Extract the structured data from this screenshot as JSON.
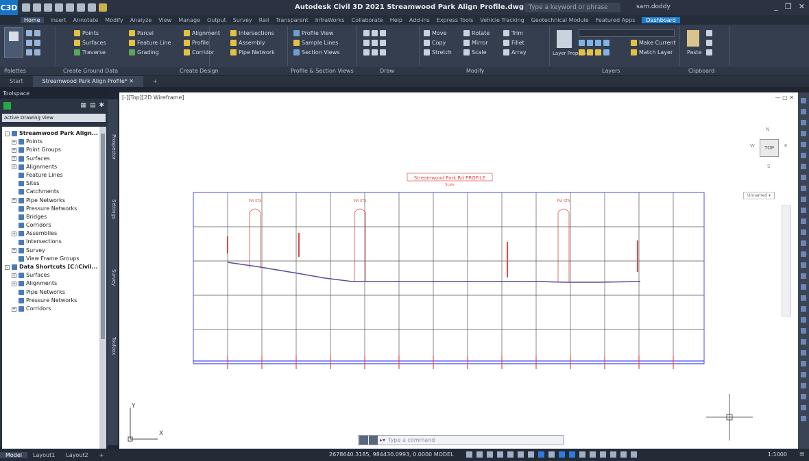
{
  "window": {
    "title": "Autodesk Civil 3D 2021   Streamwood Park Align Profile.dwg",
    "search_placeholder": "Type a keyword or phrase",
    "user": "sam.doddy",
    "min": "_",
    "restore": "❐",
    "close": "✕"
  },
  "ribbon_tabs": [
    "Home",
    "Insert",
    "Annotate",
    "Modify",
    "Analyze",
    "View",
    "Manage",
    "Output",
    "Survey",
    "Rail",
    "Transparent",
    "InfraWorks",
    "Collaborate",
    "Help",
    "Add-ins",
    "Express Tools",
    "Vehicle Tracking",
    "Geotechnical Module",
    "Featured Apps",
    "Dashboard"
  ],
  "ribbon": {
    "palettes_label": "Toolspace",
    "panels": {
      "palettes": "Palettes",
      "create_ground": "Create Ground Data",
      "create_design": "Create Design",
      "profile_section": "Profile & Section Views",
      "draw": "Draw",
      "modify": "Modify",
      "layers": "Layers",
      "clipboard": "Clipboard"
    },
    "create_ground_items": [
      "Points",
      "Surfaces",
      "Traverse"
    ],
    "create_ground_items2": [
      "Parcel",
      "Feature Line",
      "Grading"
    ],
    "create_design_items": [
      "Alignment",
      "Profile",
      "Corridor"
    ],
    "create_design_items2": [
      "Intersections",
      "Assembly",
      "Pipe Network"
    ],
    "profile_items": [
      "Profile View",
      "Sample Lines",
      "Section Views"
    ],
    "modify_items": [
      "Move",
      "Copy",
      "Stretch"
    ],
    "modify_items2": [
      "Rotate",
      "Mirror",
      "Scale"
    ],
    "modify_items3": [
      "Trim",
      "Fillet",
      "Array"
    ],
    "layers_items": [
      "Make Current",
      "Match Layer"
    ],
    "layers_props": "Layer Properties",
    "paste": "Paste"
  },
  "doc_tabs": [
    "Start",
    "Streamwood Park Align Profile*"
  ],
  "doc_tab_close": "✕",
  "doc_tab_add": "+",
  "toolspace": {
    "title": "Toolspace",
    "view_selector": "Active Drawing View",
    "tree": [
      {
        "label": "Streamwood Park Align...",
        "level": 0,
        "expander": "-"
      },
      {
        "label": "Points",
        "level": 1,
        "expander": "+"
      },
      {
        "label": "Point Groups",
        "level": 1,
        "expander": "+"
      },
      {
        "label": "Surfaces",
        "level": 1,
        "expander": "+"
      },
      {
        "label": "Alignments",
        "level": 1,
        "expander": "+"
      },
      {
        "label": "Feature Lines",
        "level": 1,
        "expander": ""
      },
      {
        "label": "Sites",
        "level": 1,
        "expander": ""
      },
      {
        "label": "Catchments",
        "level": 1,
        "expander": ""
      },
      {
        "label": "Pipe Networks",
        "level": 1,
        "expander": "+"
      },
      {
        "label": "Pressure Networks",
        "level": 1,
        "expander": ""
      },
      {
        "label": "Bridges",
        "level": 1,
        "expander": ""
      },
      {
        "label": "Corridors",
        "level": 1,
        "expander": ""
      },
      {
        "label": "Assemblies",
        "level": 1,
        "expander": "+"
      },
      {
        "label": "Intersections",
        "level": 1,
        "expander": ""
      },
      {
        "label": "Survey",
        "level": 1,
        "expander": "+"
      },
      {
        "label": "View Frame Groups",
        "level": 1,
        "expander": ""
      },
      {
        "label": "Data Shortcuts [C:\\Civil...",
        "level": 0,
        "expander": "-"
      },
      {
        "label": "Surfaces",
        "level": 1,
        "expander": "+"
      },
      {
        "label": "Alignments",
        "level": 1,
        "expander": "+"
      },
      {
        "label": "Pipe Networks",
        "level": 1,
        "expander": ""
      },
      {
        "label": "Pressure Networks",
        "level": 1,
        "expander": ""
      },
      {
        "label": "Corridors",
        "level": 1,
        "expander": "+"
      }
    ],
    "side_tabs": [
      "Prospector",
      "Settings",
      "Survey",
      "Toolbox"
    ]
  },
  "canvas": {
    "viewport_label": "[-][Top][2D Wireframe]",
    "controls": "— ▢ ✕",
    "viewcube_face": "TOP",
    "viewcube_n": "N",
    "viewcube_s": "S",
    "viewcube_w": "W",
    "viewcube_e": "E",
    "wcs": "Unnamed ▾",
    "profile_title": "Streamwood Park Rd PROFILE",
    "profile_subtitle": "Scale",
    "vpi_labels": [
      "PVI STA",
      "PVI STA",
      "PVI STA"
    ],
    "ucs_x": "X",
    "ucs_y": "Y"
  },
  "command_line": {
    "prefix": "▸▾",
    "placeholder": "Type a command"
  },
  "statusbar": {
    "tabs": [
      "Model",
      "Layout1",
      "Layout2"
    ],
    "add": "+",
    "coords": "2678640.3185, 984430.0993, 0.0000",
    "mode": "MODEL",
    "zoom": "1:1000"
  }
}
